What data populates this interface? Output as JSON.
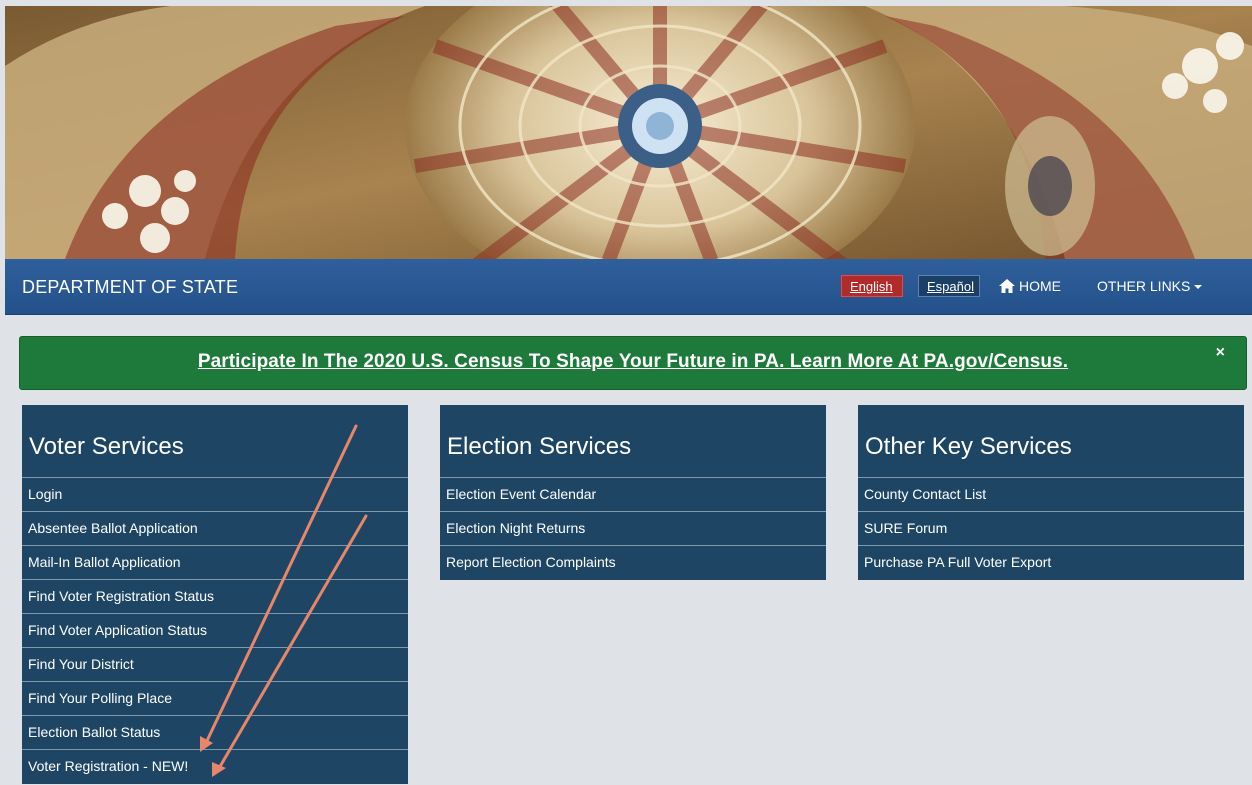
{
  "nav": {
    "brand": "DEPARTMENT OF STATE",
    "english": "English",
    "espanol": "Español",
    "home": "HOME",
    "other_links": "OTHER LINKS"
  },
  "alert": {
    "text": "Participate In The 2020 U.S. Census To Shape Your Future in PA. Learn More At PA.gov/Census.",
    "close": "×"
  },
  "panels": {
    "voter": {
      "title": "Voter Services",
      "items": [
        "Login",
        "Absentee Ballot Application",
        "Mail-In Ballot Application",
        "Find Voter Registration Status",
        "Find Voter Application Status",
        "Find Your District",
        "Find Your Polling Place",
        "Election Ballot Status",
        "Voter Registration - NEW!"
      ]
    },
    "election": {
      "title": "Election Services",
      "items": [
        "Election Event Calendar",
        "Election Night Returns",
        "Report Election Complaints"
      ]
    },
    "other": {
      "title": "Other Key Services",
      "items": [
        "County Contact List",
        "SURE Forum",
        "Purchase PA Full Voter Export"
      ]
    }
  },
  "icons": {
    "home": "home-icon",
    "caret": "caret-down-icon",
    "close": "close-icon",
    "banner": "capitol-dome-image"
  },
  "colors": {
    "navbar": "#2f5f9c",
    "alert": "#1d7a3a",
    "panel": "#1e4664",
    "english": "#b32a2a",
    "espanol": "#1c3f66",
    "arrow": "#e8866a"
  }
}
